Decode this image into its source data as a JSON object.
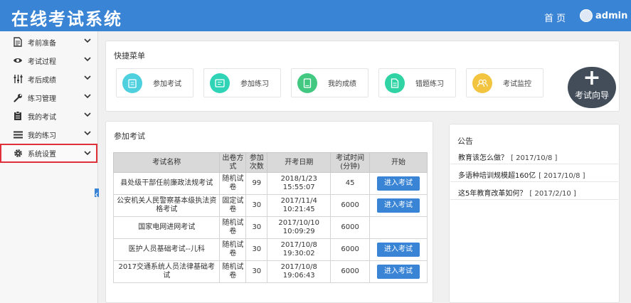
{
  "header": {
    "app_title": "在线考试系统",
    "home_label": "首 页",
    "user_name": "admin"
  },
  "sidebar": {
    "items": [
      {
        "label": "考前准备",
        "icon": "document-icon"
      },
      {
        "label": "考试过程",
        "icon": "eye-icon"
      },
      {
        "label": "考后成绩",
        "icon": "sliders-icon"
      },
      {
        "label": "练习管理",
        "icon": "wrench-icon"
      },
      {
        "label": "我的考试",
        "icon": "clipboard-icon"
      },
      {
        "label": "我的练习",
        "icon": "list-icon"
      },
      {
        "label": "系统设置",
        "icon": "gear-icon"
      }
    ]
  },
  "quick_menu": {
    "title": "快捷菜单",
    "items": [
      {
        "label": "参加考试",
        "color": "#4ed0df"
      },
      {
        "label": "参加练习",
        "color": "#2fd3b6"
      },
      {
        "label": "我的成绩",
        "color": "#43c882"
      },
      {
        "label": "错题练习",
        "color": "#2fd3a4"
      },
      {
        "label": "考试监控",
        "color": "#f2c43f"
      }
    ],
    "wizard_label": "考试向导"
  },
  "exams": {
    "title": "参加考试",
    "headers": [
      "考试名称",
      "出卷方式",
      "参加次数",
      "开考日期",
      "考试时间(分钟)",
      "开始"
    ],
    "rows": [
      {
        "name": "县处级干部任前廉政法规考试",
        "mode": "随机试卷",
        "count": "99",
        "date": "2018/1/23 15:55:07",
        "duration": "45",
        "action": "进入考试"
      },
      {
        "name": "公安机关人民警察基本级执法资格考试",
        "mode": "固定试卷",
        "count": "30",
        "date": "2017/11/4 10:21:45",
        "duration": "6000",
        "action": "进入考试"
      },
      {
        "name": "国家电网进网考试",
        "mode": "随机试卷",
        "count": "30",
        "date": "2017/10/10 10:09:29",
        "duration": "6000",
        "action": ""
      },
      {
        "name": "医护人员基础考试--儿科",
        "mode": "随机试卷",
        "count": "30",
        "date": "2017/10/8 19:30:02",
        "duration": "6000",
        "action": "进入考试"
      },
      {
        "name": "2017交通系统人员法律基础考试",
        "mode": "随机试卷",
        "count": "30",
        "date": "2017/10/8 19:06:43",
        "duration": "6000",
        "action": "进入考试"
      }
    ]
  },
  "notices": {
    "title": "公告",
    "items": [
      {
        "text": "教育该怎么做？",
        "date": "[ 2017/10/8 ]"
      },
      {
        "text": "多语种培训规模超160亿",
        "date": "[ 2017/10/8 ]"
      },
      {
        "text": "这5年教育改革如何？",
        "date": "[ 2017/2/10 ]"
      }
    ]
  },
  "theme": {
    "accent": "#3a84d6",
    "highlight_border": "#e0313b",
    "wizard_bg": "#424d59"
  }
}
